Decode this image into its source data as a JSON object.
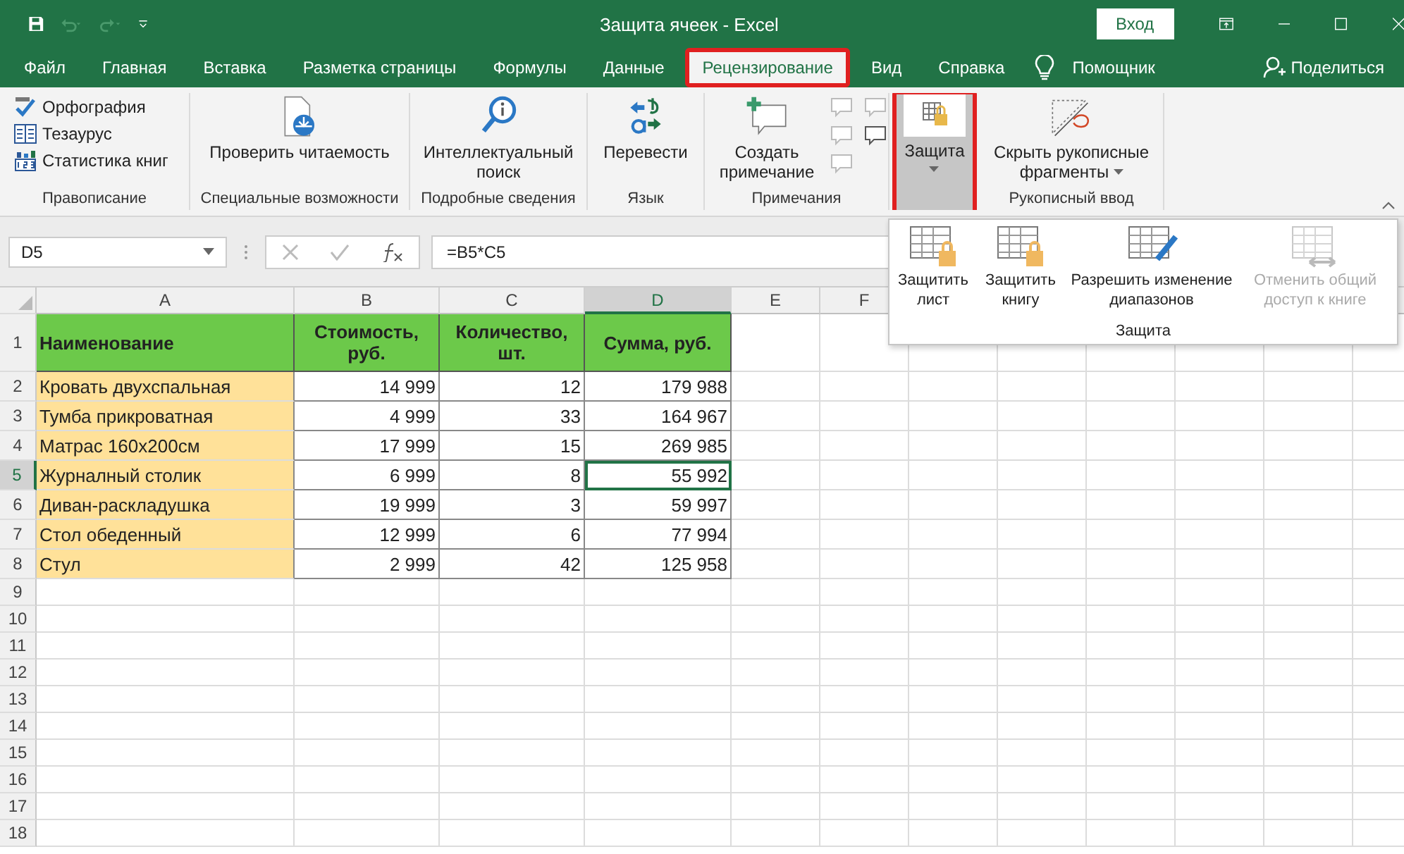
{
  "window": {
    "title": "Защита ячеек  -  Excel",
    "sign_in": "Вход"
  },
  "tabs": [
    {
      "label": "Файл",
      "selected": false,
      "highlighted": false
    },
    {
      "label": "Главная",
      "selected": false,
      "highlighted": false
    },
    {
      "label": "Вставка",
      "selected": false,
      "highlighted": false
    },
    {
      "label": "Разметка страницы",
      "selected": false,
      "highlighted": false
    },
    {
      "label": "Формулы",
      "selected": false,
      "highlighted": false
    },
    {
      "label": "Данные",
      "selected": false,
      "highlighted": false
    },
    {
      "label": "Рецензирование",
      "selected": true,
      "highlighted": true
    },
    {
      "label": "Вид",
      "selected": false,
      "highlighted": false
    },
    {
      "label": "Справка",
      "selected": false,
      "highlighted": false
    }
  ],
  "assistant": "Помощник",
  "share": "Поделиться",
  "ribbon_groups": [
    {
      "label": "Правописание",
      "items": [
        {
          "kind": "small",
          "label": "Орфография"
        },
        {
          "kind": "small",
          "label": "Тезаурус"
        },
        {
          "kind": "small",
          "label": "Статистика книг"
        }
      ]
    },
    {
      "label": "Специальные возможности",
      "items": [
        {
          "kind": "large",
          "label": "Проверить читаемость",
          "dropdown": false,
          "pressed": false,
          "highlighted": false
        }
      ]
    },
    {
      "label": "Подробные сведения",
      "items": [
        {
          "kind": "large",
          "label": "Интеллектуальный поиск",
          "dropdown": false,
          "pressed": false,
          "highlighted": false
        }
      ]
    },
    {
      "label": "Язык",
      "items": [
        {
          "kind": "large",
          "label": "Перевести",
          "dropdown": false,
          "pressed": false,
          "highlighted": false
        }
      ]
    },
    {
      "label": "Примечания",
      "items": [
        {
          "kind": "large",
          "label": "Создать примечание",
          "dropdown": false,
          "pressed": false,
          "highlighted": false
        },
        {
          "kind": "comment-tools"
        }
      ]
    },
    {
      "items": [
        {
          "kind": "large",
          "label": "Защита",
          "dropdown": true,
          "pressed": true,
          "highlighted": true
        }
      ]
    },
    {
      "label": "Рукописный ввод",
      "items": [
        {
          "kind": "large",
          "label": "Скрыть рукописные фрагменты",
          "dropdown": true,
          "pressed": false,
          "highlighted": false
        }
      ]
    }
  ],
  "protect_menu": {
    "label": "Защита",
    "items": [
      {
        "label": "Защитить лист",
        "disabled": false
      },
      {
        "label": "Защитить книгу",
        "disabled": false
      },
      {
        "label": "Разрешить изменение диапазонов",
        "disabled": false
      },
      {
        "label": "Отменить общий доступ к книге",
        "disabled": true
      }
    ]
  },
  "formula_bar": {
    "name_box": "D5",
    "formula": "=B5*C5"
  },
  "sheet": {
    "columns": [
      {
        "label": "A",
        "selected": false
      },
      {
        "label": "B",
        "selected": false
      },
      {
        "label": "C",
        "selected": false
      },
      {
        "label": "D",
        "selected": true
      },
      {
        "label": "E",
        "selected": false
      },
      {
        "label": "F",
        "selected": false
      }
    ],
    "rows": [
      {
        "number": "1",
        "selected": false,
        "kind": "header",
        "cells": [
          "Наименование",
          "Стоимость, руб.",
          "Количество, шт.",
          "Сумма, руб."
        ]
      },
      {
        "number": "2",
        "selected": false,
        "kind": "data",
        "cells": [
          "Кровать двухспальная",
          "14 999",
          "12",
          "179 988"
        ]
      },
      {
        "number": "3",
        "selected": false,
        "kind": "data",
        "cells": [
          "Тумба прикроватная",
          "4 999",
          "33",
          "164 967"
        ]
      },
      {
        "number": "4",
        "selected": false,
        "kind": "data",
        "cells": [
          "Матрас 160х200см",
          "17 999",
          "15",
          "269 985"
        ]
      },
      {
        "number": "5",
        "selected": true,
        "kind": "data",
        "cells": [
          "Журналный столик",
          "6 999",
          "8",
          "55 992"
        ]
      },
      {
        "number": "6",
        "selected": false,
        "kind": "data",
        "cells": [
          "Диван-раскладушка",
          "19 999",
          "3",
          "59 997"
        ]
      },
      {
        "number": "7",
        "selected": false,
        "kind": "data",
        "cells": [
          "Стол обеденный",
          "12 999",
          "6",
          "77 994"
        ]
      },
      {
        "number": "8",
        "selected": false,
        "kind": "data",
        "cells": [
          "Стул",
          "2 999",
          "42",
          "125 958"
        ]
      },
      {
        "number": "9",
        "selected": false,
        "kind": "empty"
      },
      {
        "number": "10",
        "selected": false,
        "kind": "empty"
      },
      {
        "number": "11",
        "selected": false,
        "kind": "empty"
      },
      {
        "number": "12",
        "selected": false,
        "kind": "empty"
      },
      {
        "number": "13",
        "selected": false,
        "kind": "empty"
      },
      {
        "number": "14",
        "selected": false,
        "kind": "empty"
      },
      {
        "number": "15",
        "selected": false,
        "kind": "empty"
      },
      {
        "number": "16",
        "selected": false,
        "kind": "empty"
      },
      {
        "number": "17",
        "selected": false,
        "kind": "empty"
      },
      {
        "number": "18",
        "selected": false,
        "kind": "empty"
      }
    ]
  }
}
